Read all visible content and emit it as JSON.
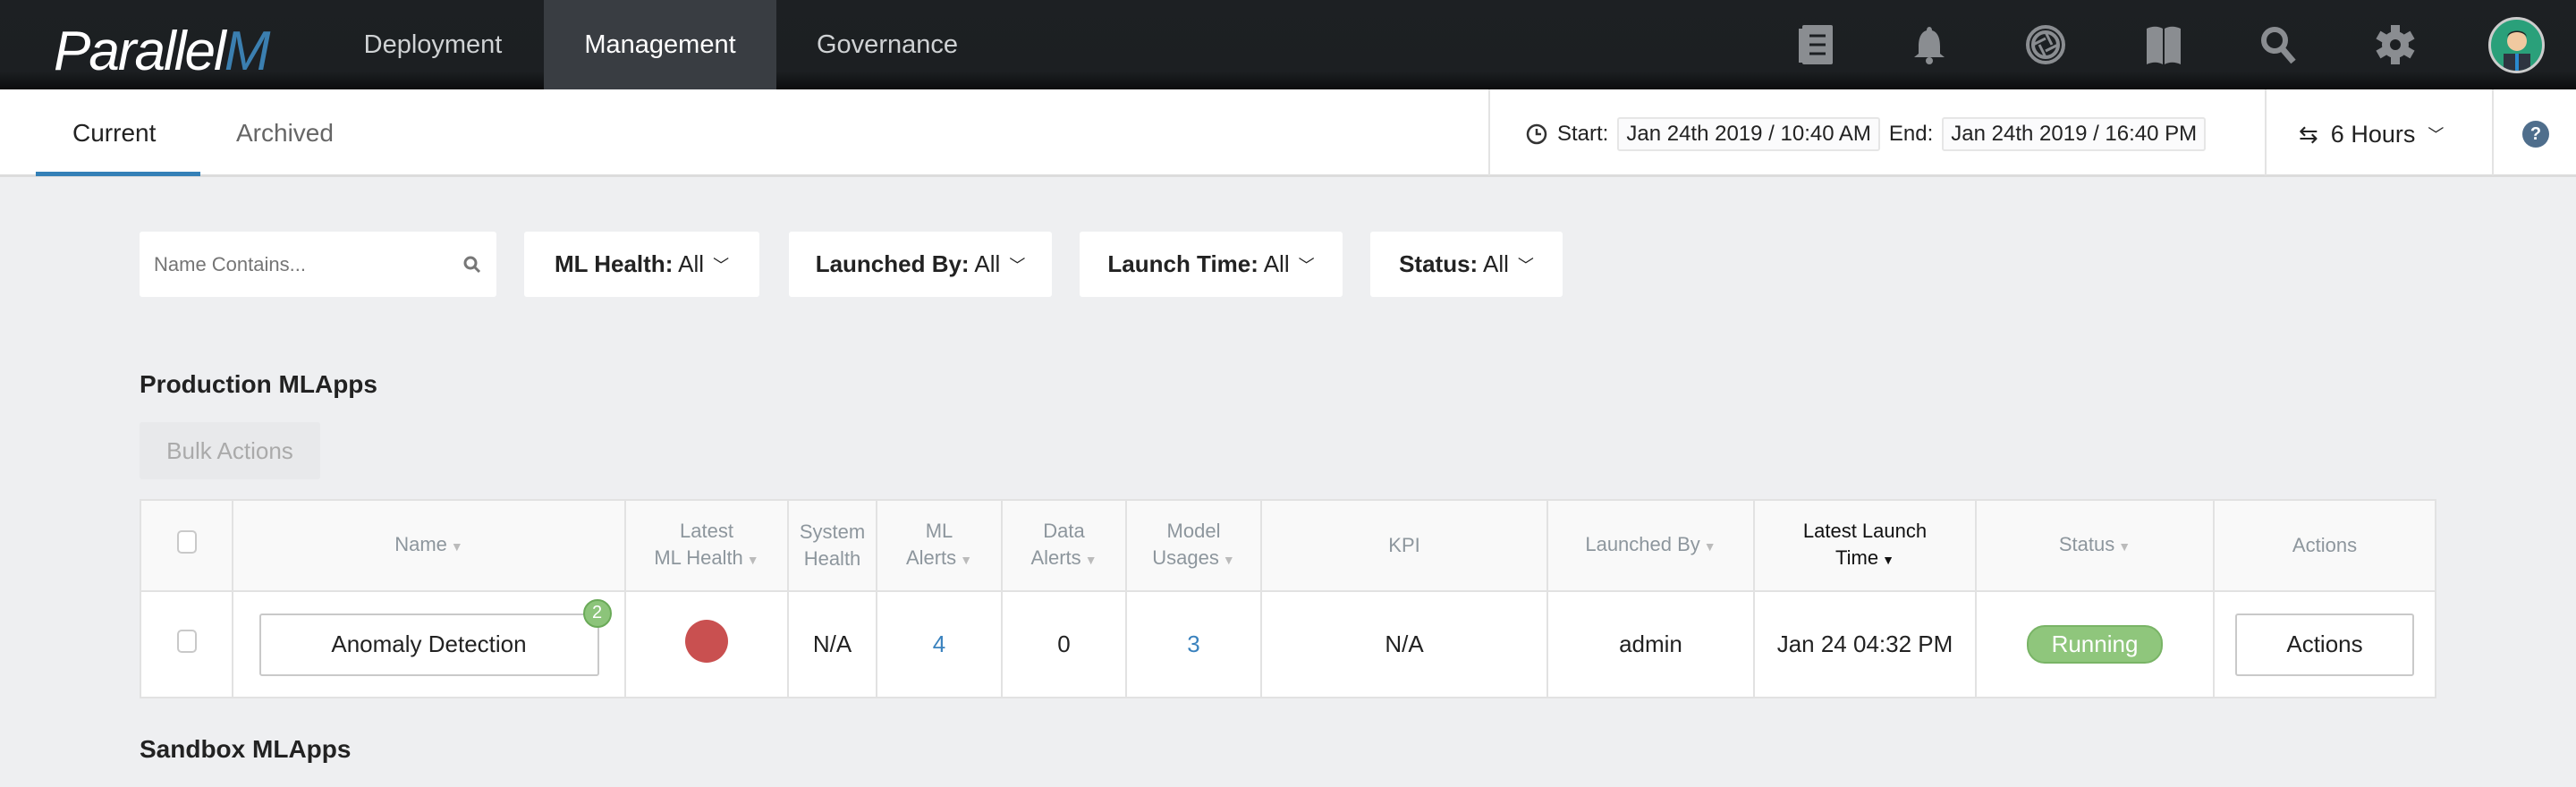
{
  "header": {
    "logo": "Parallel",
    "logo_mark": "M",
    "nav": [
      "Deployment",
      "Management",
      "Governance"
    ],
    "active_nav": "Management",
    "icons": [
      "documents-icon",
      "bell-icon",
      "aperture-icon",
      "book-icon",
      "search-icon",
      "gear-icon"
    ]
  },
  "subbar": {
    "tabs": [
      "Current",
      "Archived"
    ],
    "active_tab": "Current",
    "start_label": "Start:",
    "start_value": "Jan 24th 2019 / 10:40 AM",
    "end_label": "End:",
    "end_value": "Jan 24th 2019 / 16:40 PM",
    "range": "6 Hours",
    "help": "?"
  },
  "filters": {
    "search_placeholder": "Name Contains...",
    "items": [
      {
        "label": "ML Health:",
        "value": "All"
      },
      {
        "label": "Launched By:",
        "value": "All"
      },
      {
        "label": "Launch Time:",
        "value": "All"
      },
      {
        "label": "Status:",
        "value": "All"
      }
    ]
  },
  "production": {
    "title": "Production MLApps",
    "bulk_actions": "Bulk Actions",
    "columns": {
      "name": "Name",
      "health1": "Latest",
      "health2": "ML Health",
      "sys1": "System",
      "sys2": "Health",
      "mla1": "ML",
      "mla2": "Alerts",
      "da1": "Data",
      "da2": "Alerts",
      "mu1": "Model",
      "mu2": "Usages",
      "kpi": "KPI",
      "launched_by": "Launched By",
      "llt1": "Latest Launch",
      "llt2": "Time",
      "status": "Status",
      "actions": "Actions"
    },
    "rows": [
      {
        "name": "Anomaly Detection",
        "badge": "2",
        "ml_health": "red",
        "ml_health_color": "#c95050",
        "system_health": "N/A",
        "ml_alerts": "4",
        "data_alerts": "0",
        "model_usages": "3",
        "kpi": "N/A",
        "launched_by": "admin",
        "latest_launch_time": "Jan 24 04:32 PM",
        "status": "Running",
        "status_color": "#8fc67c",
        "actions": "Actions"
      }
    ]
  },
  "sandbox": {
    "title": "Sandbox MLApps"
  }
}
